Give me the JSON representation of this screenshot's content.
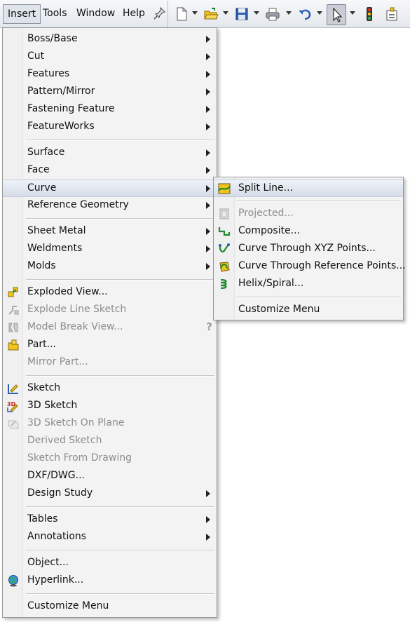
{
  "menubar": {
    "items": [
      {
        "id": "insert",
        "label": "Insert",
        "active": true
      },
      {
        "id": "tools",
        "label": "Tools"
      },
      {
        "id": "window",
        "label": "Window"
      },
      {
        "id": "help",
        "label": "Help"
      }
    ]
  },
  "toolbar": {
    "icons": [
      "pin-icon",
      "new-document-icon",
      "open-folder-icon",
      "save-icon",
      "print-icon",
      "undo-icon",
      "select-arrow-icon",
      "traffic-light-icon",
      "options-icon"
    ]
  },
  "insert_menu": {
    "items": {
      "boss_base": "Boss/Base",
      "cut": "Cut",
      "features": "Features",
      "pattern_mirror": "Pattern/Mirror",
      "fastening_feature": "Fastening Feature",
      "featureworks": "FeatureWorks",
      "surface": "Surface",
      "face": "Face",
      "curve": "Curve",
      "reference_geometry": "Reference Geometry",
      "sheet_metal": "Sheet Metal",
      "weldments": "Weldments",
      "molds": "Molds",
      "exploded_view": "Exploded View...",
      "explode_line_sketch": "Explode Line Sketch",
      "model_break_view": "Model Break View...",
      "part": "Part...",
      "mirror_part": "Mirror Part...",
      "sketch": "Sketch",
      "sketch_3d": "3D Sketch",
      "sketch_3d_on_plane": "3D Sketch On Plane",
      "derived_sketch": "Derived Sketch",
      "sketch_from_drawing": "Sketch From Drawing",
      "dxf_dwg": "DXF/DWG...",
      "design_study": "Design Study",
      "tables": "Tables",
      "annotations": "Annotations",
      "object": "Object...",
      "hyperlink": "Hyperlink...",
      "customize_menu": "Customize Menu"
    },
    "help_glyph": "?"
  },
  "curve_submenu": {
    "items": {
      "split_line": "Split Line...",
      "projected": "Projected...",
      "composite": "Composite...",
      "curve_xyz": "Curve Through XYZ Points...",
      "curve_reference": "Curve Through Reference Points...",
      "helix_spiral": "Helix/Spiral...",
      "customize_menu": "Customize Menu"
    }
  },
  "colors": {
    "menu_bg": "#f3f3f3",
    "highlight": "#d6dde8",
    "disabled_text": "#8d8d8d",
    "icon_green": "#1f8a2e",
    "icon_yellow": "#f2c31a",
    "icon_blue": "#2a5fb4"
  }
}
